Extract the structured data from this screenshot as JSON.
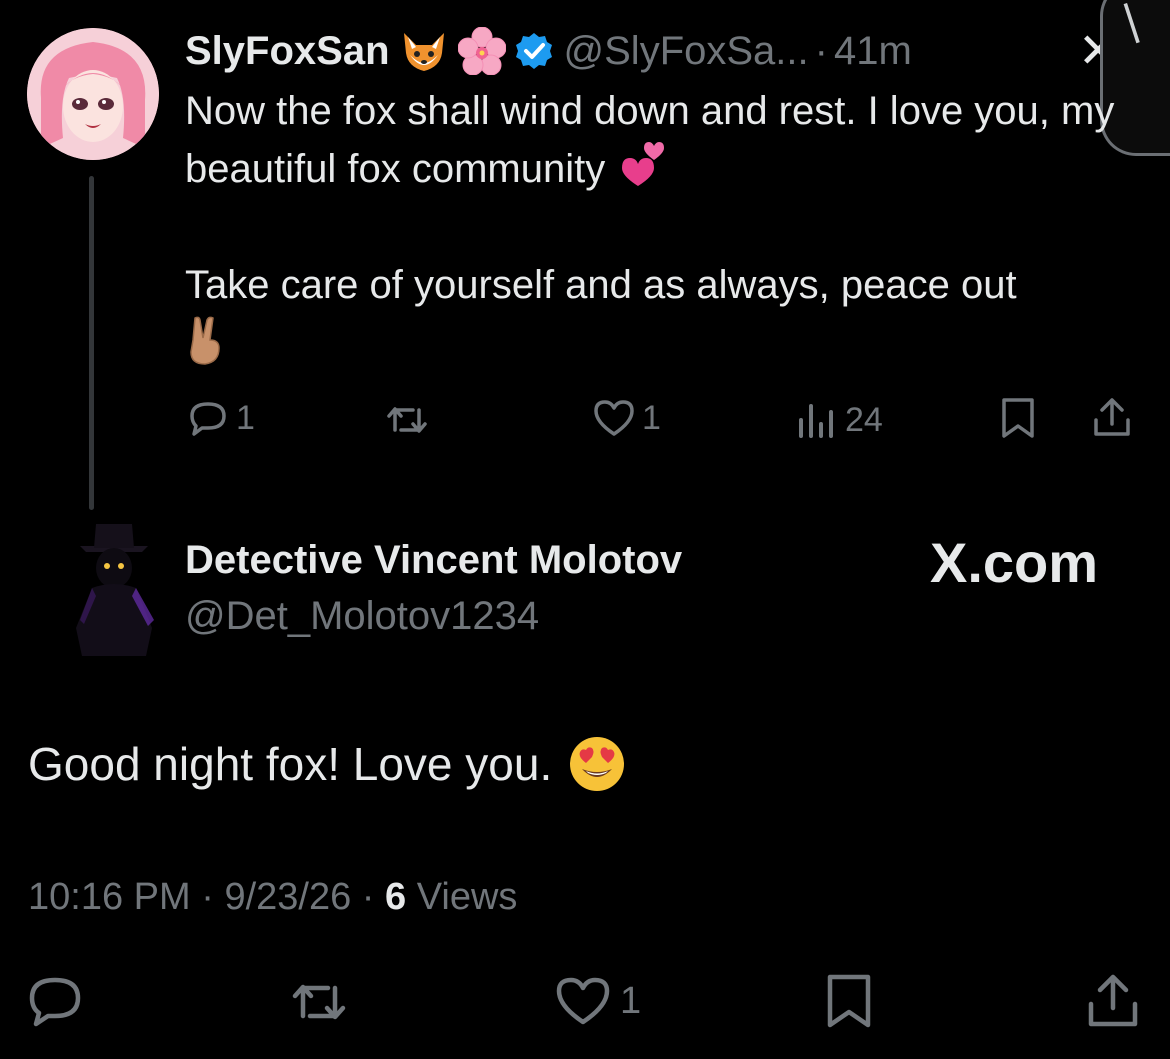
{
  "parent_tweet": {
    "display_name": "SlyFoxSan",
    "name_emojis": [
      "fox-face-emoji",
      "cherry-blossom-emoji"
    ],
    "handle": "@SlyFoxSa...",
    "separator": "·",
    "time_ago": "41m",
    "text_line_1": "Now the fox shall wind down and rest. I love you, my beautiful fox community",
    "text_line_2": "Take care of yourself and as always, peace out",
    "actions": {
      "replies": "1",
      "reposts": "",
      "likes": "1",
      "views": "24"
    }
  },
  "reply_tweet": {
    "display_name": "Detective Vincent Molotov",
    "handle": "@Det_Molotov1234",
    "brand": "X.com",
    "text": "Good night fox! Love you.",
    "timestamp": "10:16 PM",
    "date": "9/23/26",
    "meta_separator": "·",
    "views_count": "6",
    "views_label": "Views",
    "actions": {
      "likes": "1"
    }
  },
  "colors": {
    "background": "#000000",
    "text_primary": "#e7e9ea",
    "text_muted": "#71767b",
    "verified_blue": "#1d9bf0"
  }
}
